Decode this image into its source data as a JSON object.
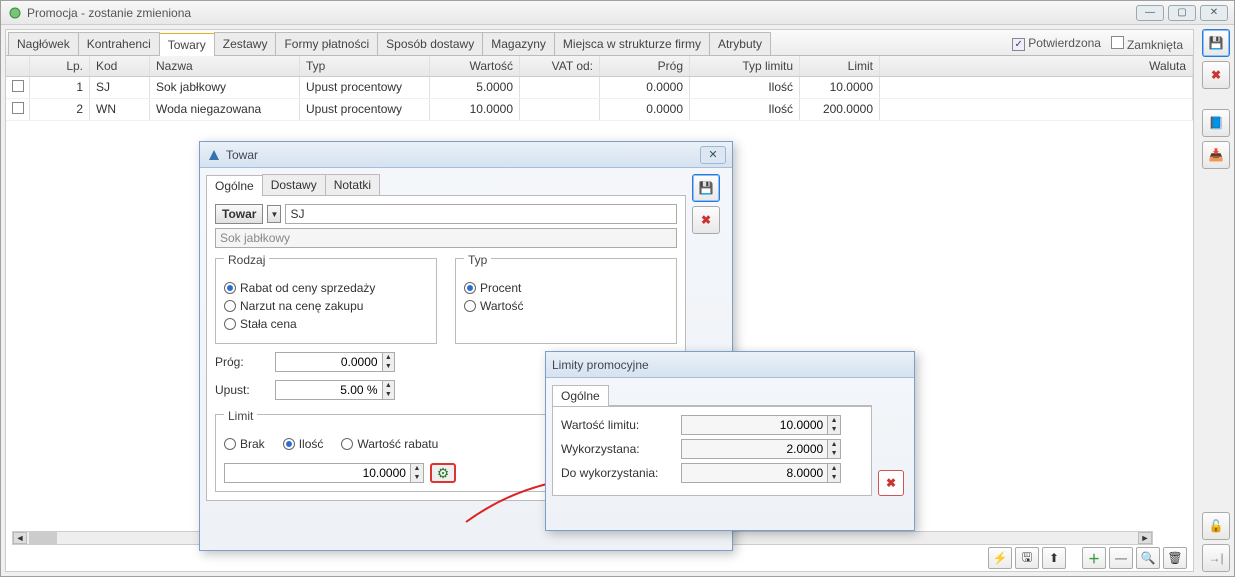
{
  "window": {
    "title": "Promocja - zostanie zmieniona",
    "confirmed_label": "Potwierdzona",
    "closed_label": "Zamknięta"
  },
  "tabs": [
    "Nagłówek",
    "Kontrahenci",
    "Towary",
    "Zestawy",
    "Formy płatności",
    "Sposób dostawy",
    "Magazyny",
    "Miejsca w strukturze firmy",
    "Atrybuty"
  ],
  "grid": {
    "columns": [
      "Lp.",
      "Kod",
      "Nazwa",
      "Typ",
      "Wartość",
      "VAT od:",
      "Próg",
      "Typ limitu",
      "Limit",
      "Waluta"
    ],
    "rows": [
      {
        "lp": "1",
        "kod": "SJ",
        "nazwa": "Sok jabłkowy",
        "typ": "Upust procentowy",
        "wart": "5.0000",
        "vat": "",
        "prog": "0.0000",
        "tlim": "Ilość",
        "lim": "10.0000",
        "wal": ""
      },
      {
        "lp": "2",
        "kod": "WN",
        "nazwa": "Woda niegazowana",
        "typ": "Upust procentowy",
        "wart": "10.0000",
        "vat": "",
        "prog": "0.0000",
        "tlim": "Ilość",
        "lim": "200.0000",
        "wal": ""
      }
    ]
  },
  "towar_dialog": {
    "title": "Towar",
    "tabs": [
      "Ogólne",
      "Dostawy",
      "Notatki"
    ],
    "towar_btn": "Towar",
    "code_value": "SJ",
    "name_value": "Sok jabłkowy",
    "rodzaj_title": "Rodzaj",
    "rodzaj_opts": [
      "Rabat od ceny sprzedaży",
      "Narzut na cenę zakupu",
      "Stała cena"
    ],
    "typ_title": "Typ",
    "typ_opts": [
      "Procent",
      "Wartość"
    ],
    "prog_label": "Próg:",
    "prog_value": "0.0000",
    "upust_label": "Upust:",
    "upust_value": "5.00 %",
    "limit_title": "Limit",
    "limit_opts": [
      "Brak",
      "Ilość",
      "Wartość rabatu"
    ],
    "limit_value": "10.0000"
  },
  "limity_dialog": {
    "title": "Limity promocyjne",
    "tab": "Ogólne",
    "wartosc_label": "Wartość limitu:",
    "wartosc_value": "10.0000",
    "wykorzystana_label": "Wykorzystana:",
    "wykorzystana_value": "2.0000",
    "do_wyk_label": "Do wykorzystania:",
    "do_wyk_value": "8.0000"
  },
  "icons": {
    "save": "💾",
    "delete": "✖",
    "book": "📘",
    "export": "📤",
    "lock": "🔓",
    "arrow_out": "↪",
    "gear": "⚙",
    "plus": "＋",
    "minus": "—",
    "search": "🔍",
    "trash": "🗑",
    "lightning": "⚡",
    "disk2": "🖫",
    "up": "⬆"
  }
}
